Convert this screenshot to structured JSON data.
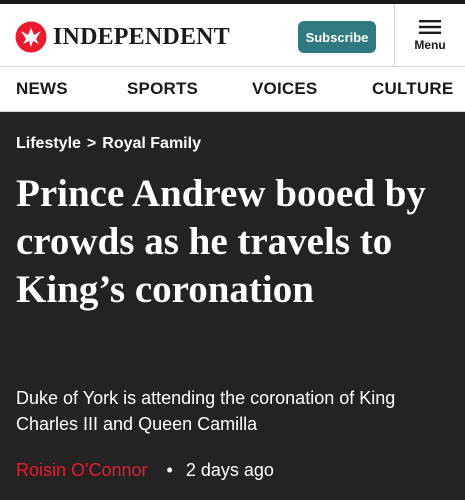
{
  "header": {
    "logo_text": "INDEPENDENT",
    "logo_icon": "eagle-icon",
    "subscribe_label": "Subscribe",
    "menu_label": "Menu",
    "menu_icon": "hamburger-icon"
  },
  "nav": {
    "items": [
      {
        "label": "NEWS"
      },
      {
        "label": "SPORTS"
      },
      {
        "label": "VOICES"
      },
      {
        "label": "CULTURE"
      }
    ]
  },
  "article": {
    "breadcrumb": [
      "Lifestyle",
      "Royal Family"
    ],
    "breadcrumb_separator": ">",
    "headline": "Prince Andrew booed by crowds as he travels to King’s coronation",
    "standfirst": "Duke of York is attending the coronation of King Charles III and Queen Camilla",
    "author": "Roisin O'Connor",
    "byline_separator": "•",
    "published": "2 days ago"
  },
  "colors": {
    "brand_red": "#ec1a2e",
    "subscribe_teal": "#2e7a80",
    "article_background": "#232323"
  }
}
